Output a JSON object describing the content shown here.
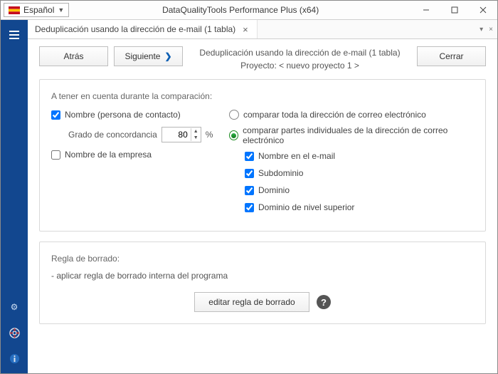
{
  "titlebar": {
    "language": "Español",
    "app_title": "DataQualityTools Performance Plus (x64)"
  },
  "tab": {
    "label": "Deduplicación usando la dirección de e-mail (1 tabla)"
  },
  "nav": {
    "back": "Atrás",
    "next": "Siguiente",
    "close": "Cerrar"
  },
  "header": {
    "title": "Deduplicación usando la dirección de e-mail (1 tabla)",
    "project": "Proyecto: < nuevo proyecto 1 >"
  },
  "compare": {
    "section_title": "A tener en cuenta durante la comparación:",
    "name_label": "Nombre (persona de contacto)",
    "degree_label": "Grado de concordancia",
    "degree_value": "80",
    "degree_unit": "%",
    "company_label": "Nombre de la empresa",
    "radio_full": "comparar toda la dirección de correo electrónico",
    "radio_parts": "comparar partes individuales de la dirección de correo electrónico",
    "part_name": "Nombre en el e-mail",
    "part_subdomain": "Subdominio",
    "part_domain": "Dominio",
    "part_tld": "Dominio de nivel superior"
  },
  "rule": {
    "title": "Regla de borrado:",
    "desc": "- aplicar regla de borrado interna del programa",
    "edit_btn": "editar regla de borrado"
  }
}
